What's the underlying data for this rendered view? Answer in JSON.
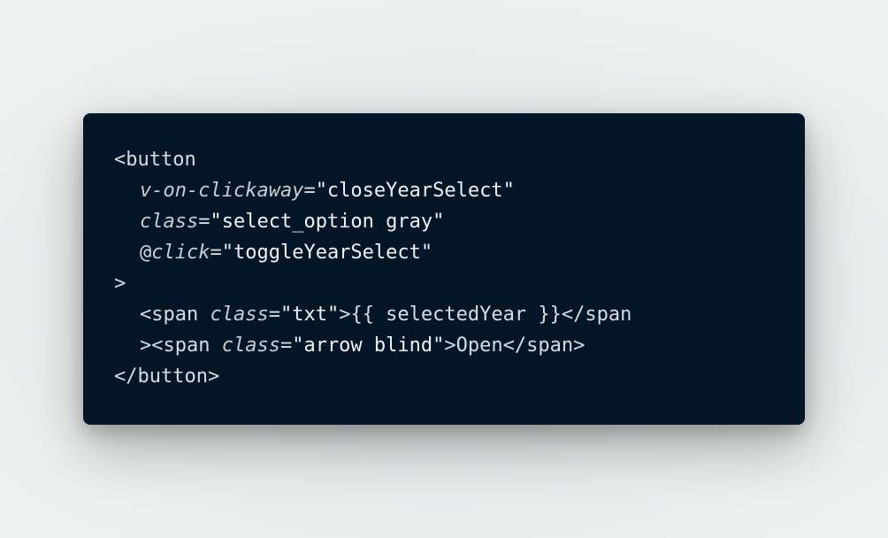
{
  "code": {
    "lines": [
      {
        "indent": 0,
        "tokens": [
          {
            "type": "punct",
            "text": "<button"
          }
        ]
      },
      {
        "indent": 1,
        "tokens": [
          {
            "type": "attr",
            "text": "v-on-clickaway"
          },
          {
            "type": "punct",
            "text": "="
          },
          {
            "type": "str",
            "text": "\"closeYearSelect\""
          }
        ]
      },
      {
        "indent": 1,
        "tokens": [
          {
            "type": "attr",
            "text": "class"
          },
          {
            "type": "punct",
            "text": "="
          },
          {
            "type": "str",
            "text": "\"select_option gray\""
          }
        ]
      },
      {
        "indent": 1,
        "tokens": [
          {
            "type": "punct",
            "text": "@"
          },
          {
            "type": "attr",
            "text": "click"
          },
          {
            "type": "punct",
            "text": "="
          },
          {
            "type": "str",
            "text": "\"toggleYearSelect\""
          }
        ]
      },
      {
        "indent": 0,
        "tokens": [
          {
            "type": "punct",
            "text": ">"
          }
        ]
      },
      {
        "indent": 1,
        "tokens": [
          {
            "type": "punct",
            "text": "<span "
          },
          {
            "type": "attr",
            "text": "class"
          },
          {
            "type": "punct",
            "text": "="
          },
          {
            "type": "str",
            "text": "\"txt\""
          },
          {
            "type": "punct",
            "text": ">{{ selectedYear }}</span"
          }
        ]
      },
      {
        "indent": 1,
        "tokens": [
          {
            "type": "punct",
            "text": "><span "
          },
          {
            "type": "attr",
            "text": "class"
          },
          {
            "type": "punct",
            "text": "="
          },
          {
            "type": "str",
            "text": "\"arrow blind\""
          },
          {
            "type": "punct",
            "text": ">Open</span>"
          }
        ]
      },
      {
        "indent": 0,
        "tokens": [
          {
            "type": "punct",
            "text": "</button>"
          }
        ]
      }
    ]
  }
}
